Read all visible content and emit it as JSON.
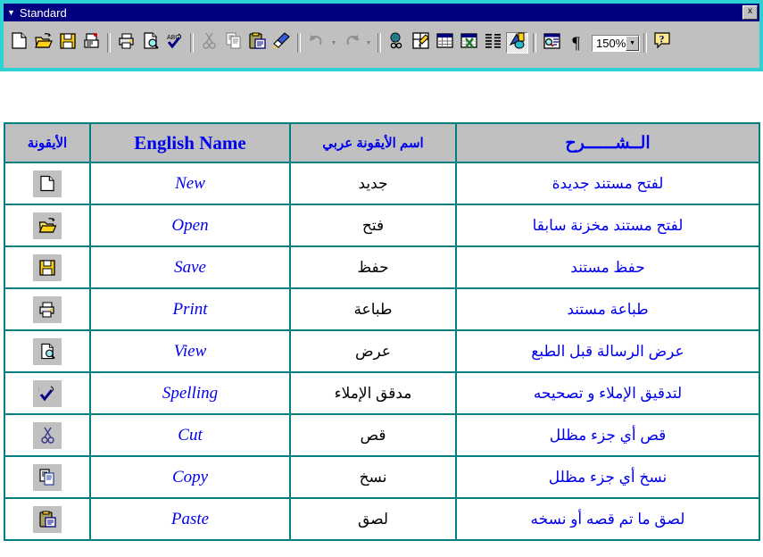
{
  "toolbar": {
    "title": "Standard",
    "handle_icon": "toolbar-grip-arrow",
    "close_label": "x",
    "zoom_value": "150%",
    "buttons": [
      {
        "name": "new-document-icon",
        "state": "normal",
        "icon": "page"
      },
      {
        "name": "open-folder-icon",
        "state": "normal",
        "icon": "folder"
      },
      {
        "name": "save-floppy-icon",
        "state": "normal",
        "icon": "floppy"
      },
      {
        "name": "email-icon",
        "state": "normal",
        "icon": "mail"
      },
      {
        "name": "print-icon",
        "state": "normal",
        "icon": "printer"
      },
      {
        "name": "print-preview-icon",
        "state": "normal",
        "icon": "preview"
      },
      {
        "name": "spelling-check-icon",
        "state": "normal",
        "icon": "abc"
      },
      {
        "name": "cut-scissors-icon",
        "state": "disabled",
        "icon": "scissors"
      },
      {
        "name": "copy-icon",
        "state": "disabled",
        "icon": "copy"
      },
      {
        "name": "paste-clipboard-icon",
        "state": "normal",
        "icon": "paste"
      },
      {
        "name": "format-painter-icon",
        "state": "normal",
        "icon": "brush"
      },
      {
        "name": "undo-icon",
        "state": "disabled",
        "icon": "undo"
      },
      {
        "name": "redo-icon",
        "state": "disabled",
        "icon": "redo"
      },
      {
        "name": "insert-hyperlink-icon",
        "state": "normal",
        "icon": "globe"
      },
      {
        "name": "tables-and-borders-icon",
        "state": "normal",
        "icon": "tablepen"
      },
      {
        "name": "insert-table-icon",
        "state": "normal",
        "icon": "table"
      },
      {
        "name": "insert-excel-sheet-icon",
        "state": "normal",
        "icon": "excel"
      },
      {
        "name": "columns-icon",
        "state": "normal",
        "icon": "columns"
      },
      {
        "name": "drawing-icon",
        "state": "pressed",
        "icon": "drawing"
      },
      {
        "name": "document-map-icon",
        "state": "normal",
        "icon": "docmap"
      },
      {
        "name": "show-formatting-marks-icon",
        "state": "normal",
        "icon": "pilcrow"
      },
      {
        "name": "help-icon",
        "state": "normal",
        "icon": "help"
      }
    ]
  },
  "table": {
    "headers": {
      "description": "الــشــــــرح",
      "arabic_name": "اسم الأيقونة عربي",
      "english_name": "English Name",
      "icon": "الأيقونة"
    },
    "rows": [
      {
        "description": "لفتح مستند جديدة",
        "arabic_name": "جديد",
        "english_name": "New",
        "icon": "page"
      },
      {
        "description": "لفتح مستند مخزنة سابقا",
        "arabic_name": "فتح",
        "english_name": "Open",
        "icon": "folder"
      },
      {
        "description": "حفظ مستند",
        "arabic_name": "حفظ",
        "english_name": "Save",
        "icon": "floppy"
      },
      {
        "description": "طباعة مستند",
        "arabic_name": "طباعة",
        "english_name": "Print",
        "icon": "printer"
      },
      {
        "description": "عرض الرسالة قبل الطبع",
        "arabic_name": "عرض",
        "english_name": "View",
        "icon": "preview"
      },
      {
        "description": "لتدقيق الإملاء و تصحيحه",
        "arabic_name": "مدقق الإملاء",
        "english_name": "Spelling",
        "icon": "abc"
      },
      {
        "description": "قص أي جزء مظلل",
        "arabic_name": "قص",
        "english_name": "Cut",
        "icon": "scissors"
      },
      {
        "description": "نسخ أي جزء مظلل",
        "arabic_name": "نسخ",
        "english_name": "Copy",
        "icon": "copy"
      },
      {
        "description": "لصق ما تم قصه أو نسخه",
        "arabic_name": "لصق",
        "english_name": "Paste",
        "icon": "paste"
      }
    ]
  },
  "colors": {
    "titlebar": "#000080",
    "toolbar_face": "#c0c0c0",
    "window_border": "#2fd2d2",
    "table_border": "#008080",
    "link_blue": "#0000ee",
    "header_fill": "#c0c0c0"
  }
}
